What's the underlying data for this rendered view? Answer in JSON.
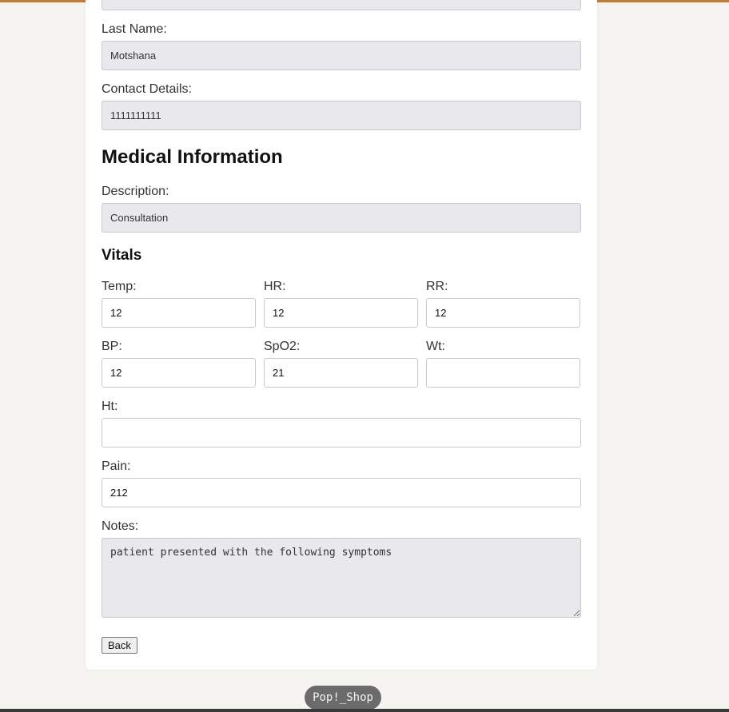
{
  "personal": {
    "last_name_label": "Last Name:",
    "last_name_value": "Motshana",
    "contact_label": "Contact Details:",
    "contact_value": "1111111111"
  },
  "medical": {
    "heading": "Medical Information",
    "description_label": "Description:",
    "description_value": "Consultation"
  },
  "vitals": {
    "heading": "Vitals",
    "temp_label": "Temp:",
    "temp_value": "12",
    "hr_label": "HR:",
    "hr_value": "12",
    "rr_label": "RR:",
    "rr_value": "12",
    "bp_label": "BP:",
    "bp_value": "12",
    "spo2_label": "SpO2:",
    "spo2_value": "21",
    "wt_label": "Wt:",
    "wt_value": "",
    "ht_label": "Ht:",
    "ht_value": "",
    "pain_label": "Pain:",
    "pain_value": "212"
  },
  "notes": {
    "label": "Notes:",
    "value": "patient presented with the following symptoms"
  },
  "actions": {
    "back_label": "Back"
  },
  "footer": {
    "badge_label": "Pop!_Shop"
  },
  "colors": {
    "accent_strip": "#b57e4a",
    "readonly_field_bg": "#e9e9ed",
    "page_bg": "#f5f4f1"
  }
}
